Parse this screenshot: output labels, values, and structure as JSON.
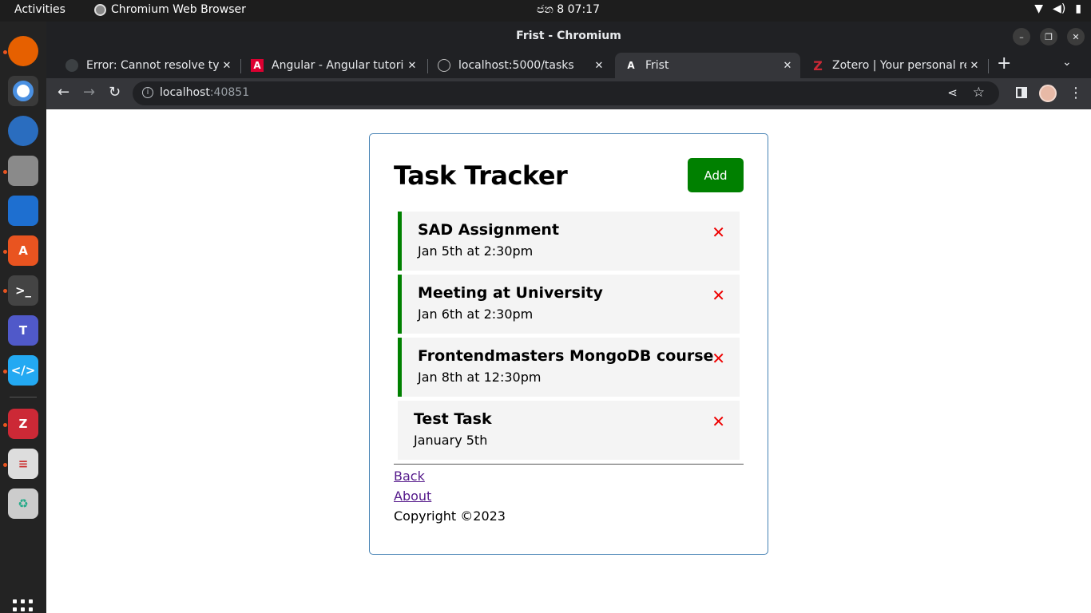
{
  "system": {
    "activities": "Activities",
    "app_name": "Chromium Web Browser",
    "clock": "ජන 8  07:17"
  },
  "window": {
    "title": "Frist - Chromium"
  },
  "tabs": [
    {
      "label": "Error: Cannot resolve typ",
      "active": false
    },
    {
      "label": "Angular - Angular tutoria",
      "active": false
    },
    {
      "label": "localhost:5000/tasks",
      "active": false
    },
    {
      "label": "Frist",
      "active": true
    },
    {
      "label": "Zotero | Your personal re",
      "active": false
    }
  ],
  "address_bar": {
    "host": "localhost",
    "port": ":40851"
  },
  "page": {
    "title": "Task Tracker",
    "add_button": "Add",
    "tasks": [
      {
        "text": "SAD Assignment",
        "day": "Jan 5th at 2:30pm",
        "reminder": true
      },
      {
        "text": "Meeting at University",
        "day": "Jan 6th at 2:30pm",
        "reminder": true
      },
      {
        "text": "Frontendmasters MongoDB course",
        "day": "Jan 8th at 12:30pm",
        "reminder": true
      },
      {
        "text": "Test Task",
        "day": "January 5th",
        "reminder": false
      }
    ],
    "footer": {
      "back_link": "Back",
      "about_link": "About",
      "copyright": "Copyright ©2023"
    }
  },
  "colors": {
    "add_button": "#008000",
    "reminder_border": "#008000",
    "delete_icon": "#ee0000",
    "container_border": "#4682b4"
  }
}
